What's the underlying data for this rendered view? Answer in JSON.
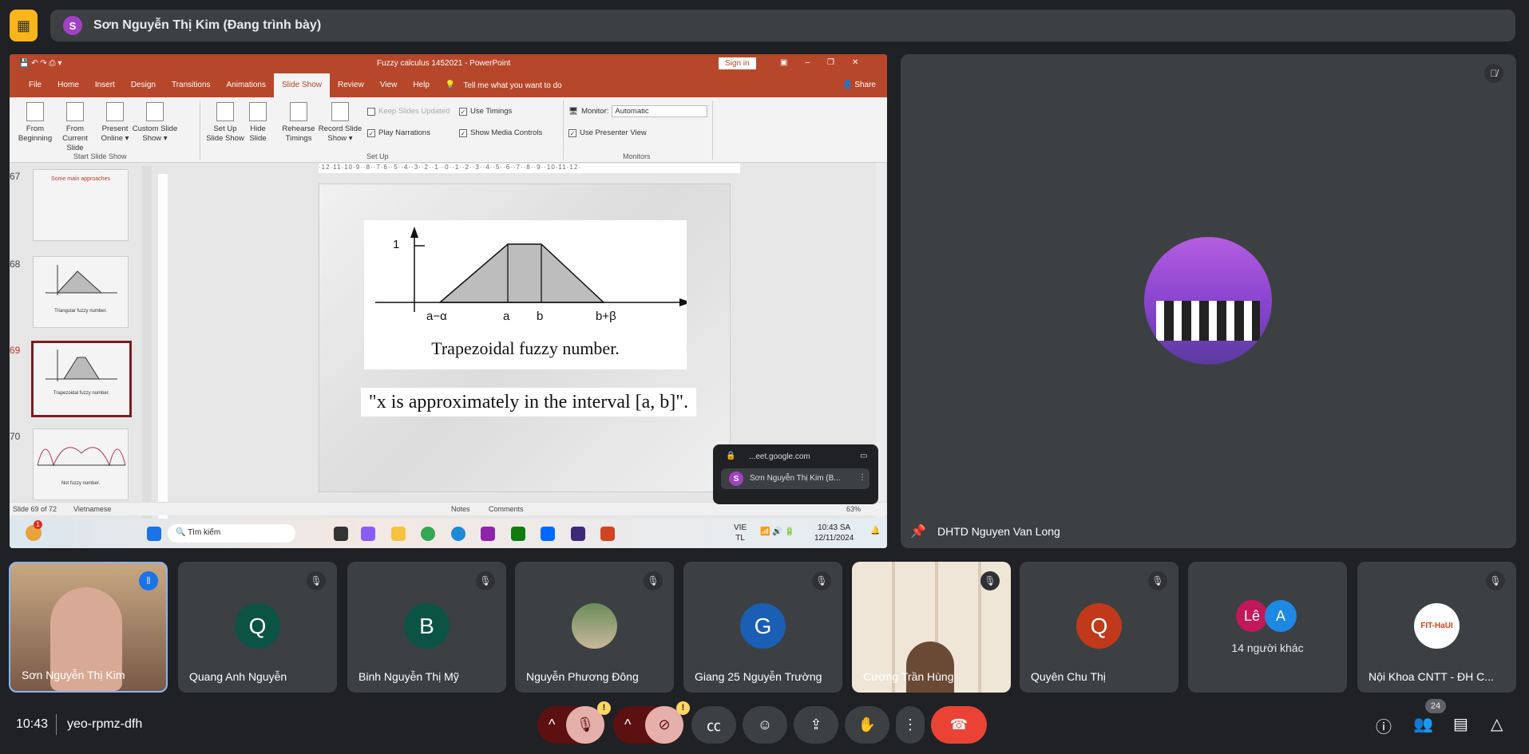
{
  "presenter_bar": {
    "avatar_letter": "S",
    "avatar_color": "#a142c4",
    "label": "Sơn Nguyễn Thị Kim (Đang trình bày)",
    "icon": "presentation-off-icon"
  },
  "powerpoint": {
    "title": "Fuzzy calculus 1452021  -  PowerPoint",
    "sign_in": "Sign in",
    "share": "Share",
    "tabs": [
      "File",
      "Home",
      "Insert",
      "Design",
      "Transitions",
      "Animations",
      "Slide Show",
      "Review",
      "View",
      "Help"
    ],
    "active_tab": "Slide Show",
    "tell_me": "Tell me what you want to do",
    "ribbon": {
      "from_beginning": "From Beginning",
      "from_current": "From Current Slide",
      "present_online": "Present Online ▾",
      "custom_show": "Custom Slide Show ▾",
      "group_start": "Start Slide Show",
      "setup": "Set Up Slide Show",
      "hide": "Hide Slide",
      "rehearse": "Rehearse Timings",
      "record": "Record Slide Show ▾",
      "keep_updated": "Keep Slides Updated",
      "play_narrations": "Play Narrations",
      "use_timings": "Use Timings",
      "show_media": "Show Media Controls",
      "group_setup": "Set Up",
      "monitor_label": "Monitor:",
      "monitor_value": "Automatic",
      "presenter_view": "Use Presenter View",
      "group_monitors": "Monitors"
    },
    "thumbnails": [
      {
        "num": "67",
        "title": "Some main approaches"
      },
      {
        "num": "68",
        "caption": "Triangular fuzzy number."
      },
      {
        "num": "69",
        "caption": "Trapezoidal fuzzy number."
      },
      {
        "num": "70",
        "caption": "Not fuzzy number."
      }
    ],
    "ruler": "·12·11·10·9··8··7·6··5··4··3··2··1··0··1··2··3··4··5··6··7··8··9··10·11·12·",
    "slide": {
      "y_tick": "1",
      "x_labels": [
        "a−α",
        "a",
        "b",
        "b+β"
      ],
      "caption": "Trapezoidal fuzzy number.",
      "quote": "\"x is approximately in the interval [a, b]\"."
    },
    "status": {
      "slide": "Slide 69 of 72",
      "language": "Vietnamese",
      "notes": "Notes",
      "comments": "Comments",
      "zoom": "63%"
    }
  },
  "taskbar": {
    "search": "Tìm kiếm",
    "lang1": "VIE",
    "lang2": "TL",
    "time": "10:43 SA",
    "date": "12/11/2024",
    "badge": "1"
  },
  "meet_popup": {
    "url": "...eet.google.com",
    "name": "Sơn Nguyễn Thị Kim (B...",
    "avatar_letter": "S"
  },
  "pinned": {
    "name": "DHTD Nguyen Van Long"
  },
  "participants": [
    {
      "name": "Sơn Nguyễn Thị Kim",
      "type": "video"
    },
    {
      "name": "Quang Anh Nguyễn",
      "letter": "Q",
      "color": "#0b5345"
    },
    {
      "name": "Binh Nguyễn Thị Mỹ",
      "letter": "B",
      "color": "#0b5345"
    },
    {
      "name": "Nguyễn Phương Đông",
      "type": "photo"
    },
    {
      "name": "Giang 25 Nguyễn Trường",
      "letter": "G",
      "color": "#1a5fb4"
    },
    {
      "name": "Cường Trần Hùng",
      "type": "video"
    },
    {
      "name": "Quyên Chu Thị",
      "letter": "Q",
      "color": "#c0391b"
    },
    {
      "name": "14 người khác",
      "letters": [
        "Lê",
        "A"
      ]
    },
    {
      "name": "Nội Khoa CNTT - ĐH C...",
      "logo": "FIT-HaUI"
    }
  ],
  "bottom": {
    "time": "10:43",
    "code": "yeo-rpmz-dfh",
    "people_count": "24"
  }
}
